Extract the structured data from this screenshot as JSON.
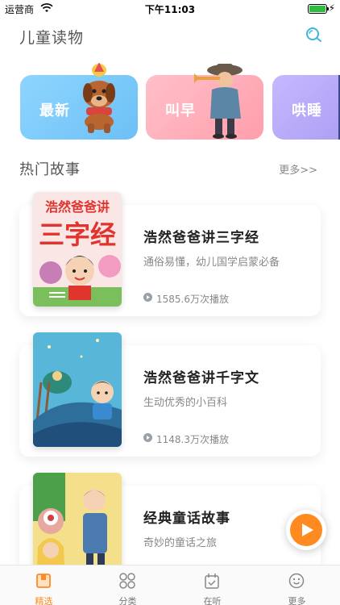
{
  "status_bar": {
    "carrier": "运营商",
    "time": "下午11:03",
    "battery_level": 1.0
  },
  "header": {
    "title": "儿童读物",
    "search_icon": "search-icon"
  },
  "categories": [
    {
      "label": "最新",
      "color": "#8ed5ff"
    },
    {
      "label": "叫早",
      "color": "#ffb1bc"
    },
    {
      "label": "哄睡",
      "color": "#b8a9fb"
    }
  ],
  "section": {
    "title": "热门故事",
    "more": "更多>>"
  },
  "stories": [
    {
      "title": "浩然爸爸讲三字经",
      "desc": "通俗易懂，幼儿国学启蒙必备",
      "plays": "1585.6万次播放",
      "cover_text_top": "浩然爸爸讲",
      "cover_text_big": "三字经"
    },
    {
      "title": "浩然爸爸讲千字文",
      "desc": "生动优秀的小百科",
      "plays": "1148.3万次播放"
    },
    {
      "title": "经典童话故事",
      "desc": "奇妙的童话之旅"
    }
  ],
  "tabs": [
    {
      "label": "精选",
      "icon": "featured-icon",
      "active": true
    },
    {
      "label": "分类",
      "icon": "category-icon",
      "active": false
    },
    {
      "label": "在听",
      "icon": "listening-icon",
      "active": false
    },
    {
      "label": "更多",
      "icon": "smiley-icon",
      "active": false
    }
  ],
  "colors": {
    "accent": "#ff8a1f"
  }
}
